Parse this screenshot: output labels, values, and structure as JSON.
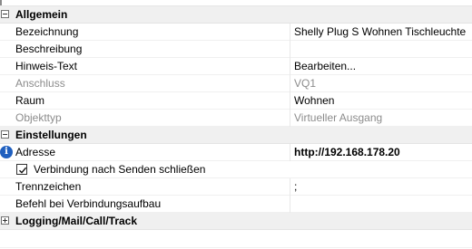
{
  "categories": {
    "allgemein": "Allgemein",
    "einstellungen": "Einstellungen",
    "logging": "Logging/Mail/Call/Track"
  },
  "rows": {
    "bezeichnung": {
      "label": "Bezeichnung",
      "value": "Shelly Plug S Wohnen Tischleuchte"
    },
    "beschreibung": {
      "label": "Beschreibung",
      "value": ""
    },
    "hinweis": {
      "label": "Hinweis-Text",
      "value": "Bearbeiten..."
    },
    "anschluss": {
      "label": "Anschluss",
      "value": "VQ1"
    },
    "raum": {
      "label": "Raum",
      "value": "Wohnen"
    },
    "objekttyp": {
      "label": "Objekttyp",
      "value": "Virtueller Ausgang"
    },
    "adresse": {
      "label": "Adresse",
      "value": "http://192.168.178.20"
    },
    "verbindung": {
      "label": "Verbindung nach Senden schließen",
      "checked": true
    },
    "trennzeichen": {
      "label": "Trennzeichen",
      "value": ";"
    },
    "befehl": {
      "label": "Befehl bei Verbindungsaufbau",
      "value": ""
    }
  },
  "icons": {
    "expanded": "collapse-box-icon",
    "collapsed": "expand-box-icon",
    "info": "info-icon",
    "check": "checkmark-icon"
  },
  "colors": {
    "category_bg": "#f0f0f0",
    "disabled_text": "#8c8c8c",
    "info_blue": "#1f5fbf"
  }
}
